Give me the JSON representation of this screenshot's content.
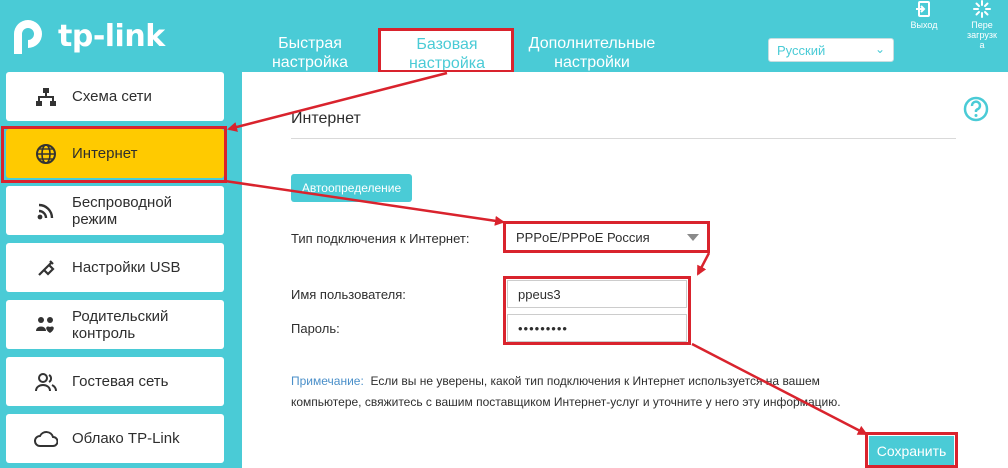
{
  "header": {
    "brand": "tp-link",
    "nav": {
      "quick_line1": "Быстрая",
      "quick_line2": "настройка",
      "basic_line1": "Базовая",
      "basic_line2": "настройка",
      "advanced_line1": "Дополнительные",
      "advanced_line2": "настройки"
    },
    "language": "Русский",
    "logout": "Выход",
    "reboot_line1": "Пере",
    "reboot_line2": "загрузк",
    "reboot_line3": "а"
  },
  "sidebar": {
    "items": [
      {
        "line1": "Схема сети",
        "line2": "",
        "icon": "network-map-icon"
      },
      {
        "line1": "Интернет",
        "line2": "",
        "icon": "globe-icon",
        "active": true
      },
      {
        "line1": "Беспроводной",
        "line2": "режим",
        "icon": "wifi-icon"
      },
      {
        "line1": "Настройки USB",
        "line2": "",
        "icon": "usb-icon"
      },
      {
        "line1": "Родительский",
        "line2": "контроль",
        "icon": "parental-control-icon"
      },
      {
        "line1": "Гостевая сеть",
        "line2": "",
        "icon": "guest-network-icon"
      },
      {
        "line1": "Облако TP-Link",
        "line2": "",
        "icon": "cloud-icon"
      }
    ]
  },
  "main": {
    "title": "Интернет",
    "auto_detect": "Автоопределение",
    "connection_type_label": "Тип подключения к Интернет:",
    "connection_type_value": "PPPoE/PPPoE Россия",
    "username_label": "Имя пользователя:",
    "username_value": "ppeus3",
    "password_label": "Пароль:",
    "password_value": "•••••••••",
    "note_lead": "Примечание:",
    "note_line1": "Если вы не уверены, какой тип подключения к Интернет используется на вашем",
    "note_line2": "компьютере, свяжитесь с вашим поставщиком Интернет-услуг и уточните у него эту информацию.",
    "save": "Сохранить"
  },
  "colors": {
    "accent": "#4acbd6",
    "active_item": "#ffca00",
    "annotation_red": "#d9232d"
  }
}
